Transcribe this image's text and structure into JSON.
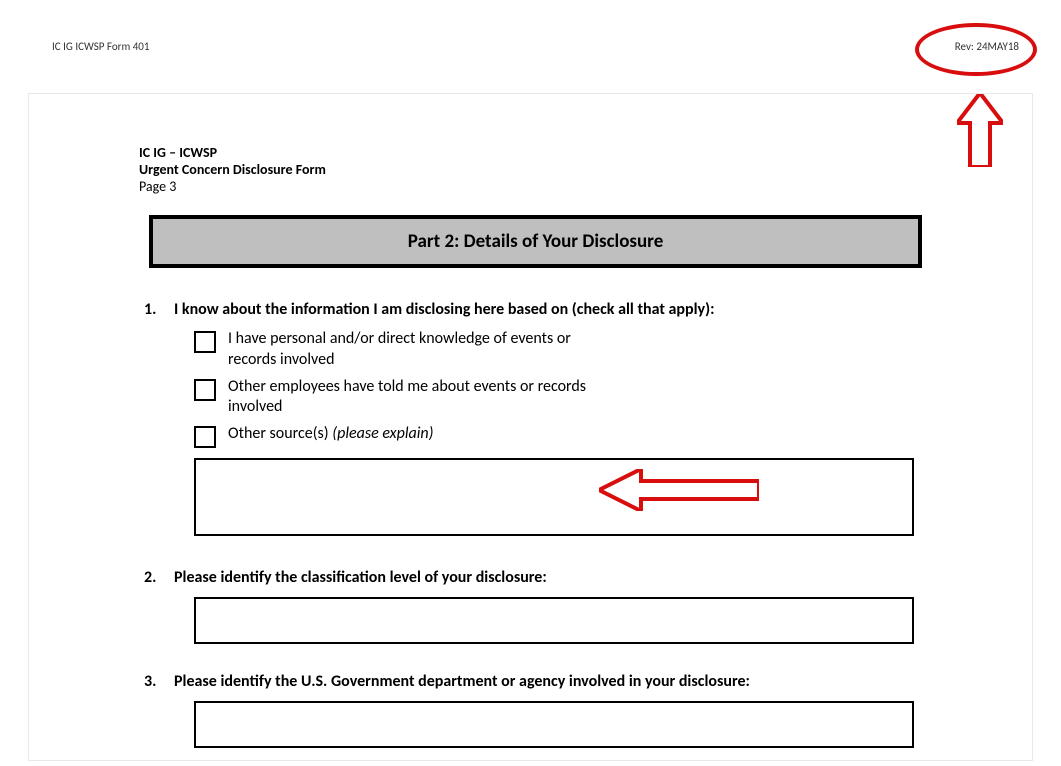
{
  "header": {
    "form_id": "IC IG ICWSP Form 401",
    "revision": "Rev: 24MAY18"
  },
  "doc_header": {
    "line1": "IC IG – ICWSP",
    "line2": "Urgent Concern Disclosure Form",
    "page_label": "Page 3"
  },
  "part_title": "Part 2: Details of Your Disclosure",
  "questions": {
    "q1": {
      "number": "1.",
      "text": "I know about the information I am disclosing here based on (check all that apply):",
      "options": [
        "I have personal and/or direct knowledge of events or records involved",
        "Other employees have told me about events or records involved",
        "Other source(s) "
      ],
      "option3_italic": "(please explain)"
    },
    "q2": {
      "number": "2.",
      "text": "Please identify the classification level of your disclosure:"
    },
    "q3": {
      "number": "3.",
      "text": "Please identify the U.S. Government department or agency involved in your disclosure:"
    }
  },
  "annotations": {
    "ellipse_color": "#d80e0e",
    "arrow_color": "#d80e0e"
  }
}
